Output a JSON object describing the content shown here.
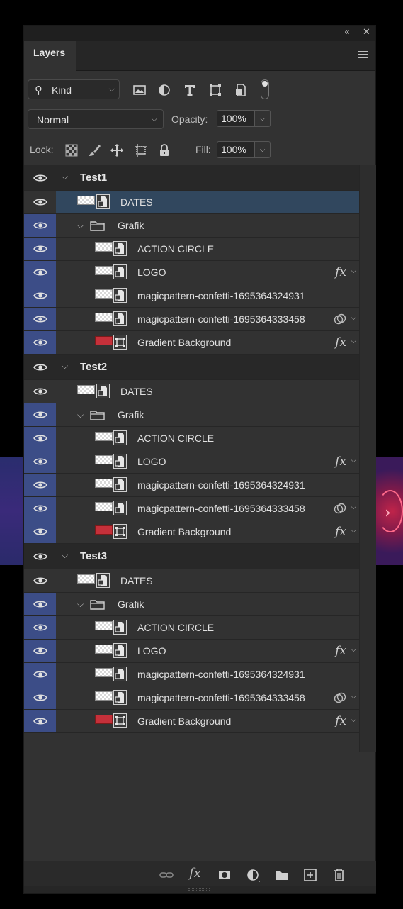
{
  "panel": {
    "collapse_icon": "«",
    "close_icon": "✕",
    "tab_label": "Layers"
  },
  "filter": {
    "kind_label": "Kind"
  },
  "blend": {
    "mode": "Normal",
    "opacity_label": "Opacity:",
    "opacity_value": "100%",
    "lock_label": "Lock:",
    "fill_label": "Fill:",
    "fill_value": "100%"
  },
  "groups": [
    {
      "name": "Test1",
      "dates": "DATES",
      "grafik": "Grafik",
      "layers": [
        "ACTION CIRCLE",
        "LOGO",
        "magicpattern-confetti-1695364324931",
        "magicpattern-confetti-1695364333458",
        "Gradient Background"
      ]
    },
    {
      "name": "Test2",
      "dates": "DATES",
      "grafik": "Grafik",
      "layers": [
        "ACTION CIRCLE",
        "LOGO",
        "magicpattern-confetti-1695364324931",
        "magicpattern-confetti-1695364333458",
        "Gradient Background"
      ]
    },
    {
      "name": "Test3",
      "dates": "DATES",
      "grafik": "Grafik",
      "layers": [
        "ACTION CIRCLE",
        "LOGO",
        "magicpattern-confetti-1695364324931",
        "magicpattern-confetti-1695364333458",
        "Gradient Background"
      ]
    }
  ],
  "fx_label": "fx",
  "colors": {
    "panel_bg": "#323232",
    "selected_row": "#31475e",
    "visibility_accent": "#3c4d87"
  }
}
